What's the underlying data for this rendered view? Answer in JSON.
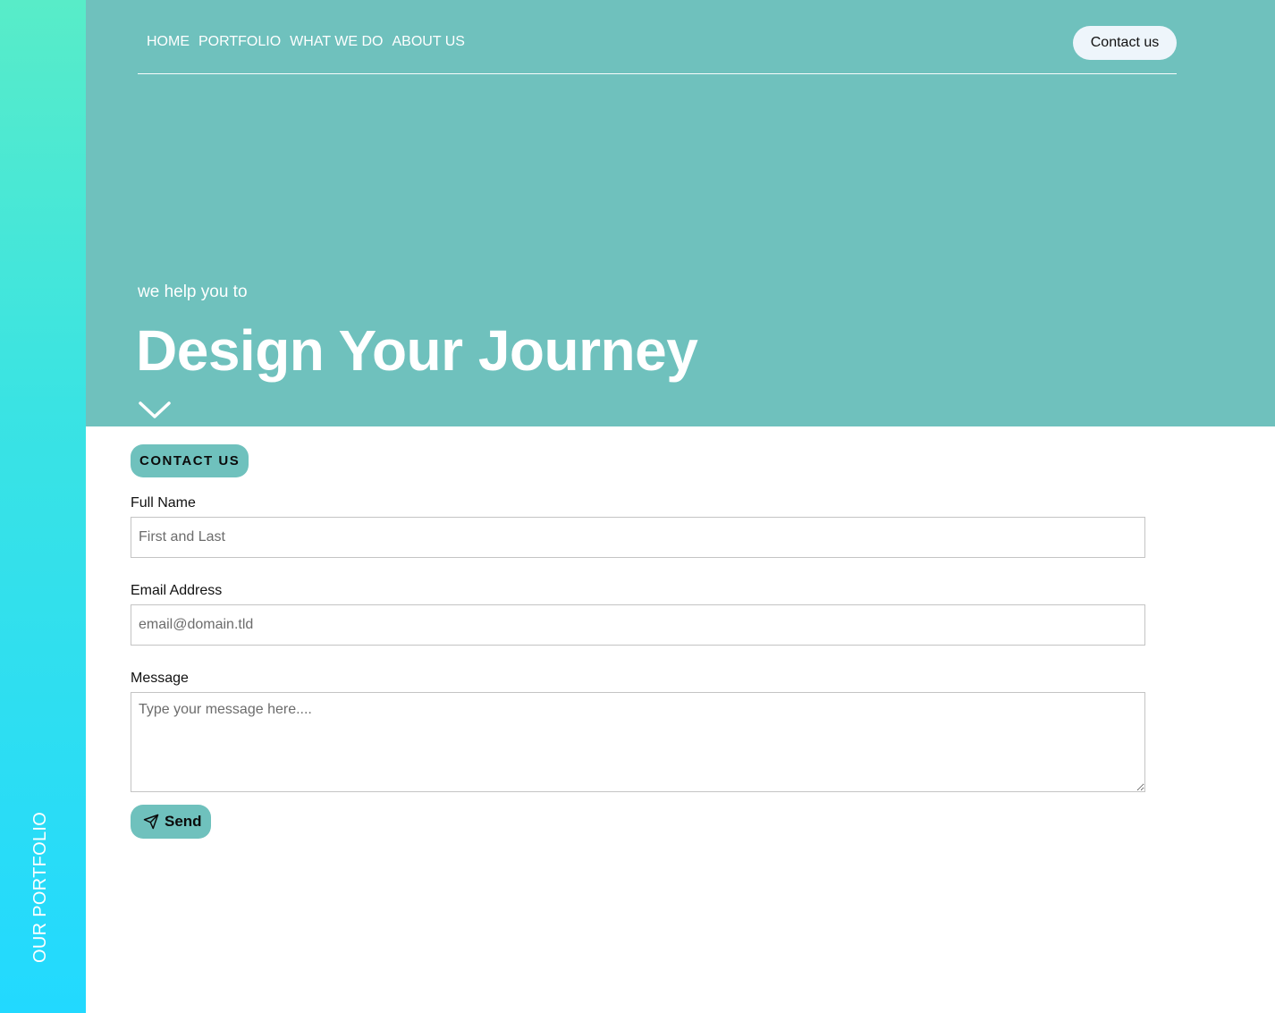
{
  "sidebar": {
    "label": "OUR PORTFOLIO"
  },
  "nav": {
    "links": [
      {
        "label": "HOME"
      },
      {
        "label": "PORTFOLIO"
      },
      {
        "label": "WHAT WE DO"
      },
      {
        "label": "ABOUT US"
      }
    ],
    "contact_button": "Contact us"
  },
  "hero": {
    "subtitle": "we help you to",
    "title": "Design Your Journey",
    "scroll_icon": "chevron-down-icon"
  },
  "form": {
    "badge": "CONTACT US",
    "full_name": {
      "label": "Full Name",
      "placeholder": "First and Last",
      "value": ""
    },
    "email": {
      "label": "Email Address",
      "placeholder": "email@domain.tld",
      "value": ""
    },
    "message": {
      "label": "Message",
      "placeholder": "Type your message here....",
      "value": ""
    },
    "send_button": "Send",
    "send_icon": "paper-plane-icon"
  },
  "colors": {
    "hero_bg": "#6fc1bd",
    "accent": "#6fc1bd",
    "sidebar_top": "#58ecc8",
    "sidebar_bottom": "#22d9ff",
    "contact_button_bg": "#eef5fb"
  }
}
